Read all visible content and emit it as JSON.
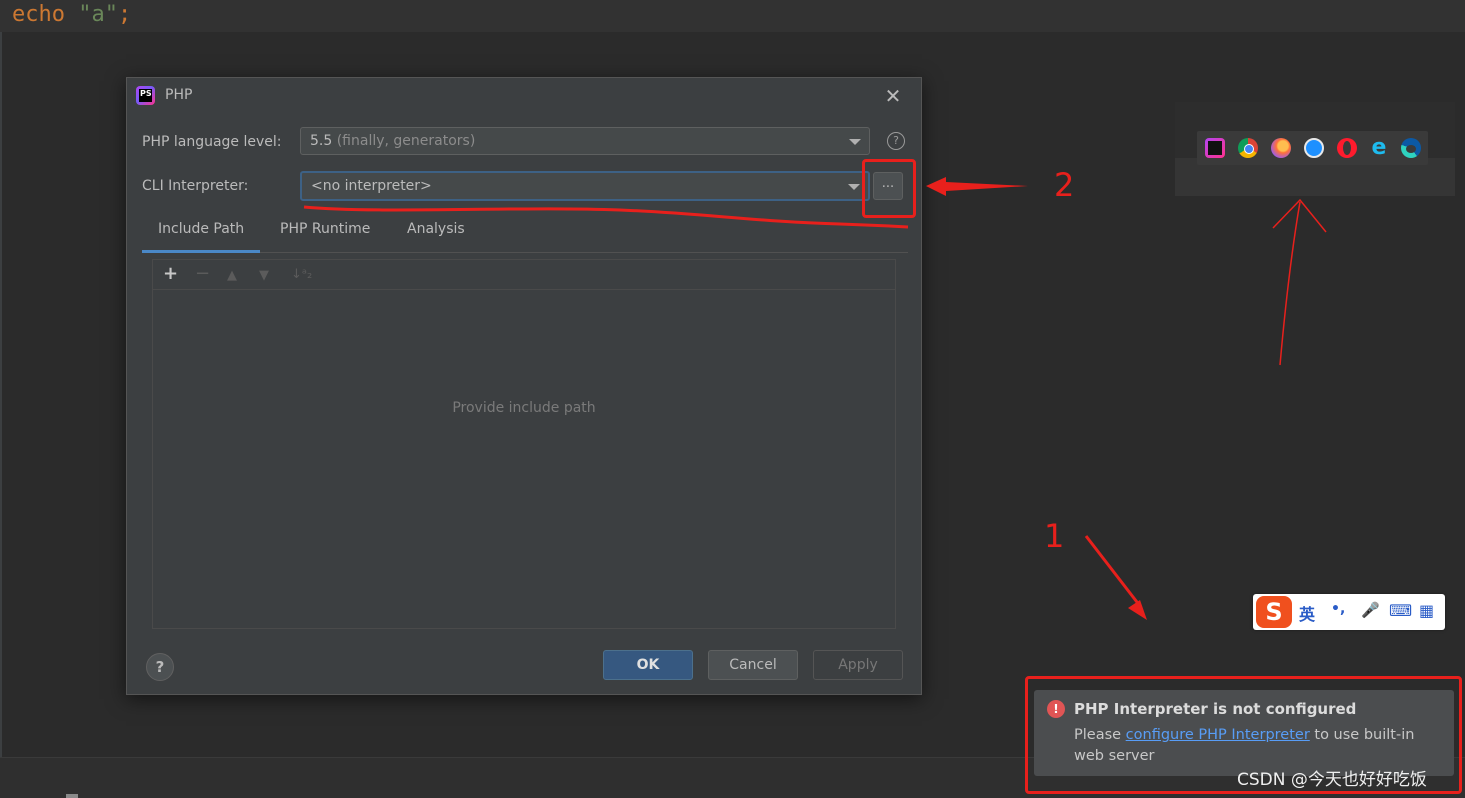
{
  "editor": {
    "code_keyword": "echo",
    "code_string": "\"a\"",
    "code_semicolon": ";"
  },
  "dialog": {
    "title": "PHP",
    "language_level_label": "PHP language level:",
    "language_level_value": "5.5",
    "language_level_hint": "(finally, generators)",
    "cli_interpreter_label": "CLI Interpreter:",
    "cli_interpreter_value": "<no interpreter>",
    "browse_button_label": "...",
    "tabs": [
      {
        "label": "Include Path",
        "active": true
      },
      {
        "label": "PHP Runtime",
        "active": false
      },
      {
        "label": "Analysis",
        "active": false
      }
    ],
    "toolbar": {
      "add": "+",
      "remove": "−",
      "move_up": "▲",
      "move_down": "▼",
      "sort": "↓ᵃ₂"
    },
    "empty_text": "Provide include path",
    "help_small": "?",
    "help_big": "?",
    "ok_label": "OK",
    "cancel_label": "Cancel",
    "apply_label": "Apply",
    "close_glyph": "✕"
  },
  "annotations": {
    "label_1": "1",
    "label_2": "2",
    "color": "#e8201c"
  },
  "tray": {
    "icons": [
      "phpstorm-icon",
      "chrome-icon",
      "firefox-icon",
      "safari-icon",
      "opera-icon",
      "ie-icon",
      "edge-icon"
    ]
  },
  "ime": {
    "logo": "S",
    "mode": "英",
    "punct": "•,",
    "mic": "🎤",
    "keyboard": "⌨",
    "apps": "▦"
  },
  "notification": {
    "title": "PHP Interpreter is not configured",
    "body_prefix": "Please ",
    "link_text": "configure PHP Interpreter",
    "body_suffix": " to use built-in web server",
    "error_glyph": "!"
  },
  "watermark": "CSDN @今天也好好吃饭",
  "colors": {
    "accent": "#4a88c7",
    "ok_button": "#365880",
    "error": "#e05555",
    "link": "#589df6"
  }
}
